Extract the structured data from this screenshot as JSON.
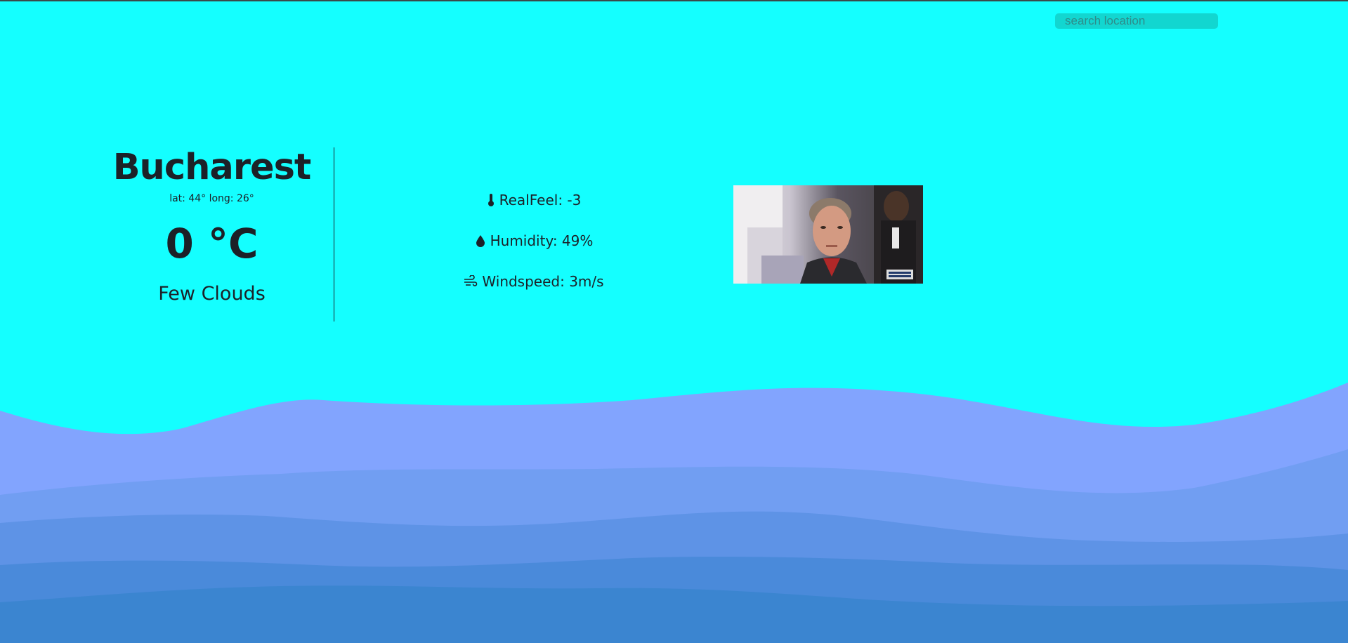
{
  "search": {
    "placeholder": "search location"
  },
  "weather": {
    "city": "Bucharest",
    "coords": "lat: 44° long: 26°",
    "temperature": "0 °C",
    "description": "Few Clouds"
  },
  "details": [
    {
      "icon": "thermometer-icon",
      "text": "RealFeel: -3"
    },
    {
      "icon": "water-drop-icon",
      "text": "Humidity: 49%"
    },
    {
      "icon": "wind-icon",
      "text": "Windspeed: 3m/s"
    }
  ],
  "colors": {
    "background": "#14ffff",
    "wave1": "#82a4fe",
    "wave2": "#719ef2",
    "wave3": "#5e93e6",
    "wave4": "#4a8ada",
    "wave5": "#3b85d0"
  }
}
